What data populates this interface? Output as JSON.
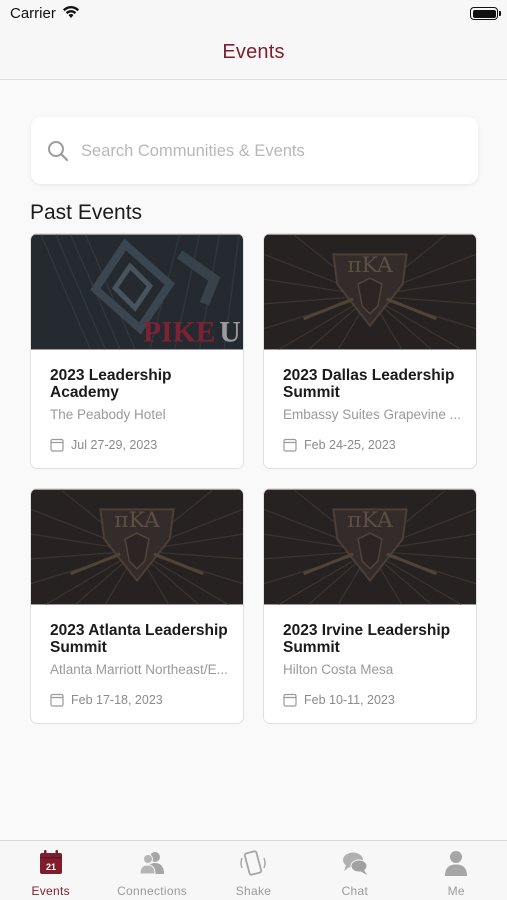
{
  "status_bar": {
    "carrier": "Carrier"
  },
  "nav": {
    "title": "Events"
  },
  "search": {
    "placeholder": "Search Communities & Events"
  },
  "section_title": "Past Events",
  "events": [
    {
      "title": "2023 Leadership Academy",
      "venue": "The Peabody Hotel",
      "date": "Jul 27-29, 2023",
      "image": "pike-university-banner",
      "image_text": "PIKE U"
    },
    {
      "title": "2023 Dallas Leadership Summit",
      "venue": "Embassy Suites Grapevine ...",
      "date": "Feb 24-25, 2023",
      "image": "pi-kappa-alpha-crest"
    },
    {
      "title": "2023 Atlanta Leadership Summit",
      "venue": "Atlanta Marriott Northeast/E...",
      "date": "Feb 17-18, 2023",
      "image": "pi-kappa-alpha-crest"
    },
    {
      "title": "2023 Irvine Leadership Summit",
      "venue": "Hilton Costa Mesa",
      "date": "Feb 10-11, 2023",
      "image": "pi-kappa-alpha-crest"
    }
  ],
  "tabs": [
    {
      "label": "Events",
      "icon": "calendar-icon",
      "badge": "21",
      "active": true
    },
    {
      "label": "Connections",
      "icon": "people-icon",
      "active": false
    },
    {
      "label": "Shake",
      "icon": "shake-phone-icon",
      "active": false
    },
    {
      "label": "Chat",
      "icon": "chat-bubbles-icon",
      "active": false
    },
    {
      "label": "Me",
      "icon": "person-icon",
      "active": false
    }
  ],
  "colors": {
    "accent": "#7f1d2c",
    "inactive_tab": "#9a9a9a",
    "card_image_bg": "#2d2827"
  }
}
